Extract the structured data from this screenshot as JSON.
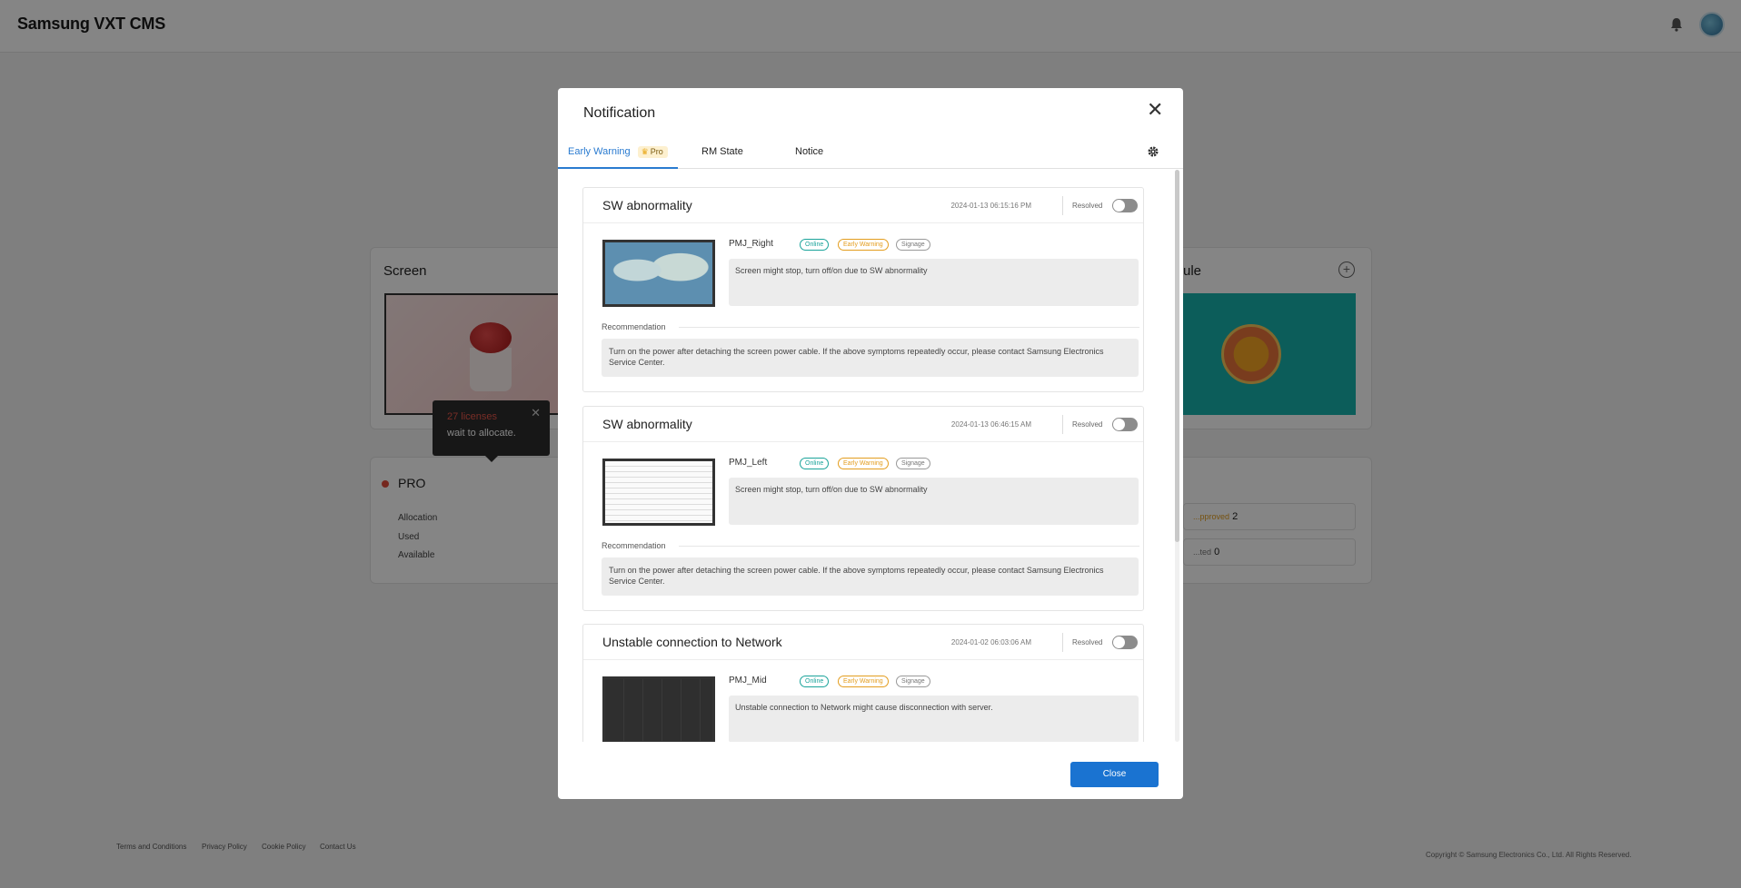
{
  "app": {
    "title": "Samsung VXT CMS"
  },
  "background": {
    "screen_card_title": "Screen",
    "schedule_card_title": "ule",
    "tooltip": {
      "licenses": "27 licenses",
      "message": "wait to allocate."
    },
    "pro": {
      "label": "PRO",
      "rows": [
        "Allocation",
        "Used",
        "Available"
      ]
    },
    "stat_boxes": [
      {
        "label": "...pproved",
        "value": "2"
      },
      {
        "label": "...ted",
        "value": "0"
      }
    ],
    "footer_links": [
      "Terms and Conditions",
      "Privacy Policy",
      "Cookie Policy",
      "Contact Us"
    ],
    "copyright": "Copyright © Samsung Electronics Co., Ltd. All Rights Reserved."
  },
  "modal": {
    "title": "Notification",
    "tabs": [
      {
        "label": "Early Warning",
        "badge": "Pro",
        "active": true
      },
      {
        "label": "RM State"
      },
      {
        "label": "Notice"
      }
    ],
    "resolved_label": "Resolved",
    "recommendation_label": "Recommendation",
    "tags": [
      "Online",
      "Early Warning",
      "Signage"
    ],
    "warnings": [
      {
        "title": "SW abnormality",
        "date": "2024-01-13 06:15:16 PM",
        "device": "PMJ_Right",
        "message": "Screen might stop, turn off/on due to SW abnormality",
        "recommendation": "Turn on the power after detaching the screen power cable. If the above symptoms repeatedly occur, please contact Samsung Electronics Service Center."
      },
      {
        "title": "SW abnormality",
        "date": "2024-01-13 06:46:15 AM",
        "device": "PMJ_Left",
        "message": "Screen might stop, turn off/on due to SW abnormality",
        "recommendation": "Turn on the power after detaching the screen power cable. If the above symptoms repeatedly occur, please contact Samsung Electronics Service Center."
      },
      {
        "title": "Unstable connection to Network",
        "date": "2024-01-02 06:03:06 AM",
        "device": "PMJ_Mid",
        "message": "Unstable connection to Network might cause disconnection with server."
      }
    ],
    "close_label": "Close"
  }
}
